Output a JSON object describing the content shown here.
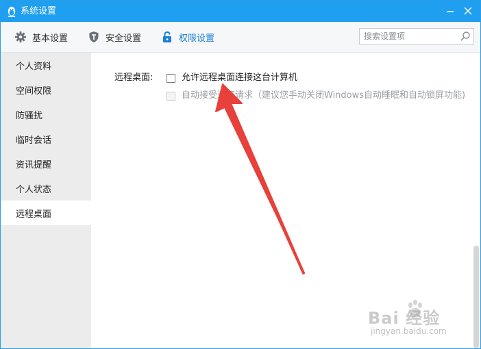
{
  "window": {
    "title": "系统设置",
    "accent_color": "#1e9ff0"
  },
  "toolbar": {
    "items": [
      {
        "label": "基本设置",
        "icon": "gear-icon"
      },
      {
        "label": "安全设置",
        "icon": "shield-icon"
      },
      {
        "label": "权限设置",
        "icon": "lock-icon",
        "active": true
      }
    ],
    "search_placeholder": "搜索设置项"
  },
  "sidebar": {
    "items": [
      {
        "label": "个人资料"
      },
      {
        "label": "空间权限"
      },
      {
        "label": "防骚扰"
      },
      {
        "label": "临时会话"
      },
      {
        "label": "资讯提醒"
      },
      {
        "label": "个人状态"
      },
      {
        "label": "远程桌面",
        "active": true
      }
    ]
  },
  "main": {
    "section_label": "远程桌面:",
    "options": [
      {
        "label": "允许远程桌面连接这台计算机",
        "checked": false,
        "enabled": true
      },
      {
        "label": "自动接受连接请求（建议您手动关闭Windows自动睡眠和自动锁屏功能)",
        "checked": false,
        "enabled": false
      }
    ]
  },
  "annotation": {
    "arrow_color": "#e8403a"
  },
  "watermark": {
    "brand": "Bai 经验",
    "url": "jingyan.baidu.com"
  }
}
